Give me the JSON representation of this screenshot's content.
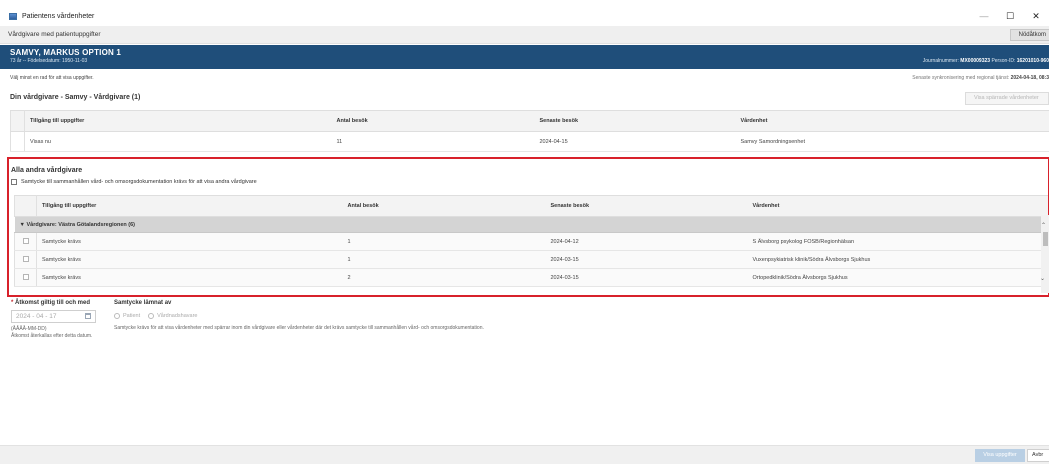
{
  "window": {
    "title": "Patientens vårdenheter",
    "controls": {
      "minimize": "—",
      "maximize": "☐",
      "close": "✕"
    }
  },
  "subheader": {
    "label": "Vårdgivare med patientuppgifter",
    "emergency_button": "Nödåtkom"
  },
  "patient": {
    "name": "SAMVY, MARKUS OPTION 1",
    "details": "73 år -- Födelsedatum: 1950-11-03",
    "journal_label": "Journalnummer:",
    "journal_number": "MX00009323",
    "person_id_label": "Person-ID:",
    "person_id": "16201010-960"
  },
  "instruction": "Välj minst en rad för att visa uppgifter.",
  "sync": {
    "label": "Senaste synkronisering med regional tjänst:",
    "value": "2024-04-18, 08:3"
  },
  "own_caregiver": {
    "title": "Din vårdgivare - Samvy - Vårdgivare (1)",
    "show_blocked_button": "Visa spärrade vårdenheter",
    "columns": [
      "Tillgång till uppgifter",
      "Antal besök",
      "Senaste besök",
      "Vårdenhet"
    ],
    "rows": [
      {
        "access": "Visas nu",
        "visits": "11",
        "last_visit": "2024-04-15",
        "unit": "Samvy Samordningsenhet"
      }
    ]
  },
  "other_caregivers": {
    "title": "Alla andra vårdgivare",
    "consent_checkbox": "Samtycke till sammanhållen vård- och omsorgsdokumentation krävs för att visa andra vårdgivare",
    "columns": [
      "Tillgång till uppgifter",
      "Antal besök",
      "Senaste besök",
      "Vårdenhet"
    ],
    "group_label": "Vårdgivare: Västra Götalandsregionen (6)",
    "rows": [
      {
        "access": "Samtycke krävs",
        "visits": "1",
        "last_visit": "2024-04-12",
        "unit": "S Älvsborg psykolog FOSB/Regionhälsan"
      },
      {
        "access": "Samtycke krävs",
        "visits": "1",
        "last_visit": "2024-03-15",
        "unit": "Vuxenpsykiatrisk klinik/Södra Älvsborgs Sjukhus"
      },
      {
        "access": "Samtycke krävs",
        "visits": "2",
        "last_visit": "2024-03-15",
        "unit": "Ortopedklinik/Södra Älvsborgs Sjukhus"
      }
    ]
  },
  "access_valid": {
    "required_marker": "*",
    "label": "Åtkomst giltig till och med",
    "date_value": "2024 - 04 - 17",
    "format_hint": "(ÅÅÅÅ-MM-DD)",
    "note": "Åtkomst återkallas efter detta datum."
  },
  "consent_given": {
    "label": "Samtycke lämnat av",
    "options": [
      "Patient",
      "Vårdnadshavare"
    ],
    "help": "Samtycke krävs för att visa vårdenheter med spärrar inom din vårdgivare eller vårdenheter där det krävs samtycke till sammanhållen vård- och omsorgsdokumentation."
  },
  "footer": {
    "show_button": "Visa uppgifter",
    "cancel_button": "Avbr"
  },
  "colors": {
    "banner": "#1f4e7a",
    "highlight_border": "#d8212b",
    "group_row": "#d4d4d4",
    "primary_disabled": "#b9cfe4"
  }
}
